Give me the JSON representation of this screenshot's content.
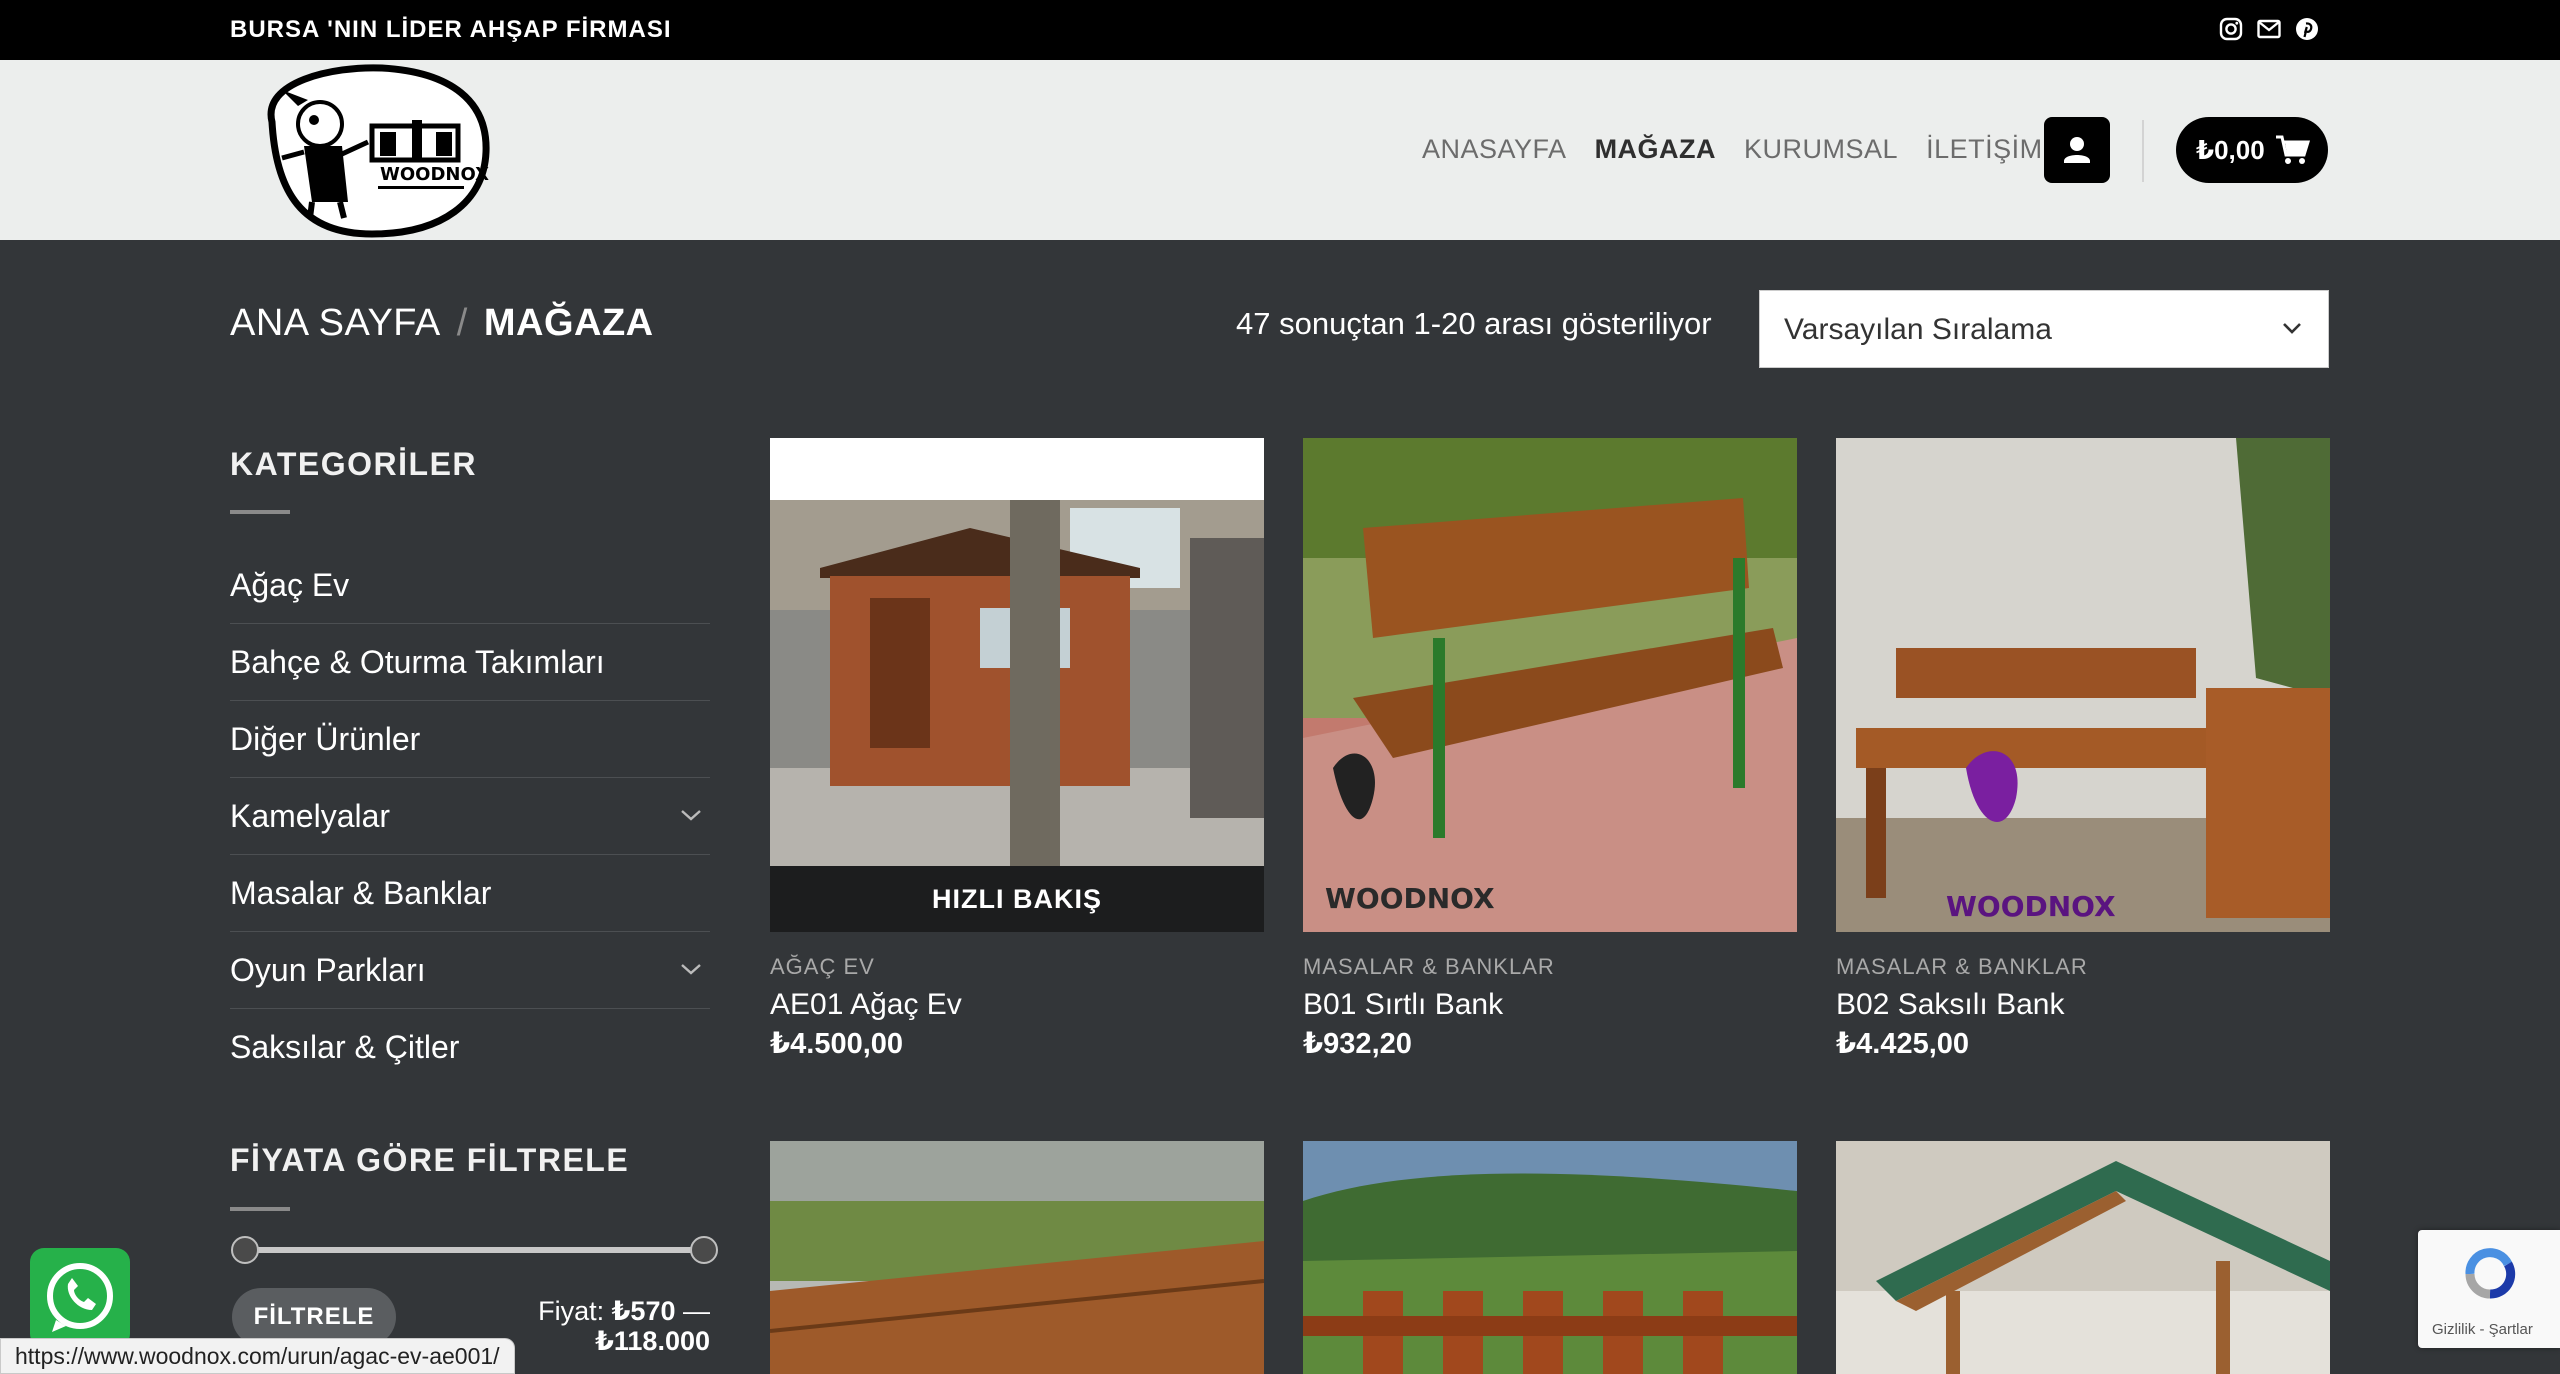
{
  "topbar": {
    "tagline": "BURSA 'NIN LİDER AHŞAP FİRMASI",
    "social_icons": [
      "instagram-icon",
      "email-icon",
      "pinterest-icon"
    ]
  },
  "header": {
    "logo_text": "WOODNOX",
    "nav": [
      "ANASAYFA",
      "MAĞAZA",
      "KURUMSAL",
      "İLETİŞİM"
    ],
    "active_nav": "MAĞAZA",
    "cart_total": "₺0,00"
  },
  "breadcrumb": {
    "home": "ANA SAYFA",
    "separator": "/",
    "current": "MAĞAZA"
  },
  "result_count": "47 sonuçtan 1-20 arası gösteriliyor",
  "sort": {
    "selected": "Varsayılan Sıralama"
  },
  "sidebar": {
    "categories_title": "KATEGORİLER",
    "categories": [
      {
        "label": "Ağaç Ev",
        "expandable": false
      },
      {
        "label": "Bahçe & Oturma Takımları",
        "expandable": false
      },
      {
        "label": "Diğer Ürünler",
        "expandable": false
      },
      {
        "label": "Kamelyalar",
        "expandable": true
      },
      {
        "label": "Masalar & Banklar",
        "expandable": false
      },
      {
        "label": "Oyun Parkları",
        "expandable": true
      },
      {
        "label": "Saksılar & Çitler",
        "expandable": false
      }
    ],
    "price_filter_title": "FİYATA GÖRE FİLTRELE",
    "filter_button": "FİLTRELE",
    "price_label": "Fiyat:",
    "price_min": "₺570",
    "price_dash": "—",
    "price_max": "₺118.000"
  },
  "products": [
    {
      "category": "AĞAÇ EV",
      "name": "AE01 Ağaç Ev",
      "price": "₺4.500,00",
      "quick_view": "HIZLI BAKIŞ"
    },
    {
      "category": "MASALAR & BANKLAR",
      "name": "B01 Sırtlı Bank",
      "price": "₺932,20"
    },
    {
      "category": "MASALAR & BANKLAR",
      "name": "B02 Saksılı Bank",
      "price": "₺4.425,00"
    }
  ],
  "status_url": "https://www.woodnox.com/urun/agac-ev-ae001/",
  "recaptcha_text": "Gizlilik - Şartlar",
  "colors": {
    "background": "#333639",
    "topbar": "#000000",
    "header": "#eceeed",
    "whatsapp": "#26b14a"
  }
}
